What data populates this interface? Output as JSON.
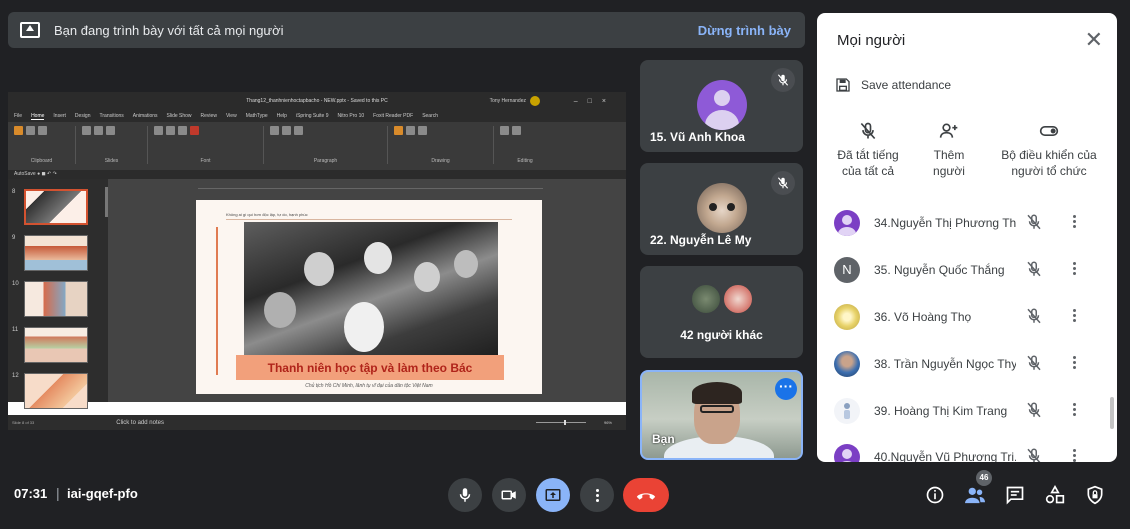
{
  "banner": {
    "text": "Bạn đang trình bày với tất cả mọi người",
    "stop_label": "Dừng trình bày"
  },
  "shared_screen": {
    "window_title": "Thang12_thanhnienhoctapbacho - NEW.pptx - Saved to this PC",
    "user_name": "Tony Hernandez",
    "tabs": [
      "File",
      "Home",
      "Insert",
      "Design",
      "Transitions",
      "Animations",
      "Slide Show",
      "Review",
      "View",
      "MathType",
      "Help",
      "iSpring Suite 9",
      "Nitro Pro 10",
      "Foxit Reader PDF",
      "Search"
    ],
    "active_tab": "Home",
    "ribbon_groups": [
      "Clipboard",
      "Slides",
      "Font",
      "Paragraph",
      "Drawing",
      "Editing"
    ],
    "slide_numbers": [
      "8",
      "9",
      "10",
      "11",
      "12"
    ],
    "slide_header": "Không ai gì quí hơn độc lập, tự do, hạnh phúc",
    "slide_title": "Thanh niên học tập và làm theo Bác",
    "slide_subcaption": "Chủ tịch Hồ Chí Minh, lãnh tụ vĩ đại của dân tộc Việt Nam",
    "notes_placeholder": "Click to add notes",
    "slide_counter": "Slide 8 of 33",
    "zoom": "96%"
  },
  "tiles": [
    {
      "name": "15. Vũ Anh Khoa",
      "avatar": "default-person-avatar",
      "muted": true
    },
    {
      "name": "22. Nguyễn Lê My",
      "avatar": "cat-photo-avatar",
      "muted": true
    },
    {
      "label": "42 người khác"
    },
    {
      "name": "Bạn",
      "self": true
    }
  ],
  "panel": {
    "title": "Mọi người",
    "save_attendance": "Save attendance",
    "actions": [
      {
        "icon": "mic-off-icon",
        "label_line1": "Đã tắt tiếng",
        "label_line2": "của tất cả"
      },
      {
        "icon": "add-person-icon",
        "label_line1": "Thêm",
        "label_line2": "người"
      },
      {
        "icon": "toggle-icon",
        "label_line1": "Bộ điều khiển của",
        "label_line2": "người tổ chức"
      }
    ],
    "participants": [
      {
        "name": "34.Nguyễn Thị Phương Th...",
        "avatar": "purple-person",
        "color": "#7b3fc4"
      },
      {
        "name": "35. Nguyễn Quốc Thắng",
        "avatar": "letter",
        "letter": "N",
        "color": "#5f6368"
      },
      {
        "name": "36. Võ Hoàng Thọ",
        "avatar": "photo-flower",
        "color": "#e8d36a"
      },
      {
        "name": "38. Trần Nguyễn Ngọc Thy",
        "avatar": "photo-blue",
        "color": "#3d6fb0"
      },
      {
        "name": "39. Hoàng Thị Kim Trang",
        "avatar": "photo-figure",
        "color": "#e3e8f0"
      },
      {
        "name": "40.Nguyễn Vũ Phương Tri...",
        "avatar": "purple-person",
        "color": "#7b3fc4"
      }
    ]
  },
  "bottom_bar": {
    "time": "07:31",
    "separator": "|",
    "meeting_code": "iai-gqef-pfo",
    "people_count": "46"
  },
  "colors": {
    "background": "#202124",
    "accent_blue": "#8ab4f8",
    "end_call_red": "#ea4335",
    "tile": "#3c4043"
  }
}
